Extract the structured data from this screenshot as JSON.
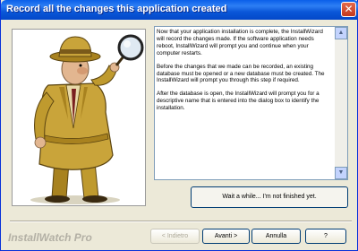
{
  "window": {
    "title": "Record all the changes this application created"
  },
  "icons": {
    "close": "close-icon",
    "scroll_up": "scroll-up-icon",
    "scroll_down": "scroll-down-icon",
    "illustration": "detective-illustration"
  },
  "info_text": {
    "paragraph1": "Now that your application installation is complete, the InstallWizard will record the changes made.  If the software application needs reboot, InstallWizard will prompt you and continue when your computer restarts.",
    "paragraph2": "Before the changes that we made can be recorded, an existing database must be opened or a new database must be created.  The InstallWizard will prompt you through this step if required.",
    "paragraph3": "After the database is open, the InstallWizard will prompt you for a descriptive name that is entered into the dialog box to identify the installation."
  },
  "wait_button_label": "Wait a while... I'm not finished yet.",
  "footer": {
    "brand": "InstallWatch Pro",
    "back_label": "< Indietro",
    "next_label": "Avanti >",
    "cancel_label": "Annulla",
    "help_label": "?"
  },
  "colors": {
    "titlebar": "#0a57d8",
    "background": "#ece9d8",
    "coat": "#c9a43a"
  }
}
